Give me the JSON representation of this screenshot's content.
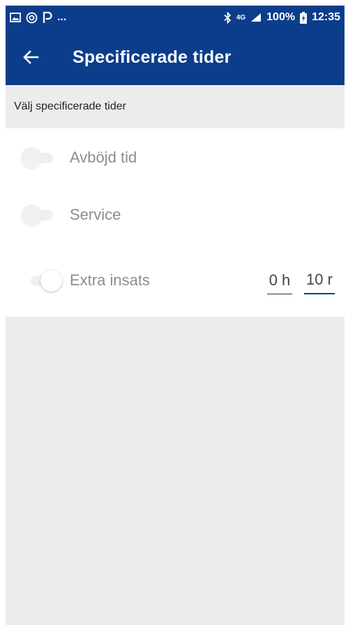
{
  "status_bar": {
    "left_icons": [
      "image-icon",
      "sync-icon",
      "p-app-icon"
    ],
    "more": "...",
    "network": "4G",
    "battery": "100%",
    "time": "12:35"
  },
  "app_bar": {
    "title": "Specificerade tider",
    "background": "#0b3d8a"
  },
  "section_header": "Välj specificerade tider",
  "rows": [
    {
      "label": "Avböjd tid",
      "toggle_on": false
    },
    {
      "label": "Service",
      "toggle_on": false
    },
    {
      "label": "Extra insats",
      "toggle_on": true,
      "hours": "0 h",
      "minutes": "10 r"
    }
  ]
}
